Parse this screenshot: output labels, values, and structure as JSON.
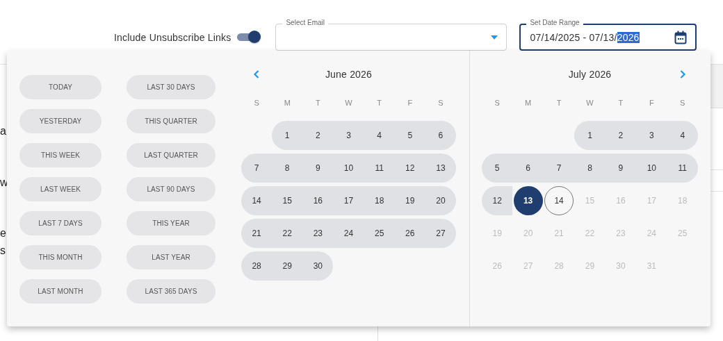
{
  "toggle": {
    "label": "Include Unsubscribe Links",
    "on": true
  },
  "email_field": {
    "label": "Select Email"
  },
  "date_field": {
    "label": "Set Date Range",
    "value": "07/14/2025 - 07/13/",
    "selected_text": "2026",
    "focused": true
  },
  "background_fragments": [
    "a",
    "w",
    "e",
    "s"
  ],
  "presets": [
    [
      "TODAY",
      "YESTERDAY",
      "THIS WEEK",
      "LAST WEEK",
      "LAST 7 DAYS",
      "THIS MONTH",
      "LAST MONTH"
    ],
    [
      "LAST 30 DAYS",
      "THIS QUARTER",
      "LAST QUARTER",
      "LAST 90 DAYS",
      "THIS YEAR",
      "LAST YEAR",
      "LAST 365 DAYS"
    ]
  ],
  "months": [
    {
      "title": "June 2026",
      "has_prev": true,
      "has_next": false,
      "weekdays": [
        "S",
        "M",
        "T",
        "W",
        "T",
        "F",
        "S"
      ],
      "weeks": [
        [
          {
            "leading_gap": true
          },
          {
            "day": "1",
            "range": true,
            "selected": false,
            "today": false,
            "disabled": false
          },
          {
            "day": "2",
            "range": true,
            "selected": false,
            "today": false,
            "disabled": false
          },
          {
            "day": "3",
            "range": true,
            "selected": false,
            "today": false,
            "disabled": false
          },
          {
            "day": "4",
            "range": true,
            "selected": false,
            "today": false,
            "disabled": false
          },
          {
            "day": "5",
            "range": true,
            "selected": false,
            "today": false,
            "disabled": false
          },
          {
            "day": "6",
            "range": true,
            "selected": false,
            "today": false,
            "disabled": false
          }
        ],
        [
          {
            "day": "7",
            "range": true,
            "selected": false,
            "today": false,
            "disabled": false
          },
          {
            "day": "8",
            "range": true,
            "selected": false,
            "today": false,
            "disabled": false
          },
          {
            "day": "9",
            "range": true,
            "selected": false,
            "today": false,
            "disabled": false
          },
          {
            "day": "10",
            "range": true,
            "selected": false,
            "today": false,
            "disabled": false
          },
          {
            "day": "11",
            "range": true,
            "selected": false,
            "today": false,
            "disabled": false
          },
          {
            "day": "12",
            "range": true,
            "selected": false,
            "today": false,
            "disabled": false
          },
          {
            "day": "13",
            "range": true,
            "selected": false,
            "today": false,
            "disabled": false
          }
        ],
        [
          {
            "day": "14",
            "range": true,
            "selected": false,
            "today": false,
            "disabled": false
          },
          {
            "day": "15",
            "range": true,
            "selected": false,
            "today": false,
            "disabled": false
          },
          {
            "day": "16",
            "range": true,
            "selected": false,
            "today": false,
            "disabled": false
          },
          {
            "day": "17",
            "range": true,
            "selected": false,
            "today": false,
            "disabled": false
          },
          {
            "day": "18",
            "range": true,
            "selected": false,
            "today": false,
            "disabled": false
          },
          {
            "day": "19",
            "range": true,
            "selected": false,
            "today": false,
            "disabled": false
          },
          {
            "day": "20",
            "range": true,
            "selected": false,
            "today": false,
            "disabled": false
          }
        ],
        [
          {
            "day": "21",
            "range": true,
            "selected": false,
            "today": false,
            "disabled": false
          },
          {
            "day": "22",
            "range": true,
            "selected": false,
            "today": false,
            "disabled": false
          },
          {
            "day": "23",
            "range": true,
            "selected": false,
            "today": false,
            "disabled": false
          },
          {
            "day": "24",
            "range": true,
            "selected": false,
            "today": false,
            "disabled": false
          },
          {
            "day": "25",
            "range": true,
            "selected": false,
            "today": false,
            "disabled": false
          },
          {
            "day": "26",
            "range": true,
            "selected": false,
            "today": false,
            "disabled": false
          },
          {
            "day": "27",
            "range": true,
            "selected": false,
            "today": false,
            "disabled": false
          }
        ],
        [
          {
            "day": "28",
            "range": true,
            "selected": false,
            "today": false,
            "disabled": false
          },
          {
            "day": "29",
            "range": true,
            "selected": false,
            "today": false,
            "disabled": false
          },
          {
            "day": "30",
            "range": true,
            "selected": false,
            "today": false,
            "disabled": false
          }
        ]
      ]
    },
    {
      "title": "July 2026",
      "has_prev": false,
      "has_next": true,
      "weekdays": [
        "S",
        "M",
        "T",
        "W",
        "T",
        "F",
        "S"
      ],
      "weeks": [
        [
          {
            "leading_gap": true
          },
          {
            "day": "1",
            "range": true,
            "selected": false,
            "today": false,
            "disabled": false
          },
          {
            "day": "2",
            "range": true,
            "selected": false,
            "today": false,
            "disabled": false
          },
          {
            "day": "3",
            "range": true,
            "selected": false,
            "today": false,
            "disabled": false
          },
          {
            "day": "4",
            "range": true,
            "selected": false,
            "today": false,
            "disabled": false
          }
        ],
        [
          {
            "day": "5",
            "range": true,
            "selected": false,
            "today": false,
            "disabled": false
          },
          {
            "day": "6",
            "range": true,
            "selected": false,
            "today": false,
            "disabled": false
          },
          {
            "day": "7",
            "range": true,
            "selected": false,
            "today": false,
            "disabled": false
          },
          {
            "day": "8",
            "range": true,
            "selected": false,
            "today": false,
            "disabled": false
          },
          {
            "day": "9",
            "range": true,
            "selected": false,
            "today": false,
            "disabled": false
          },
          {
            "day": "10",
            "range": true,
            "selected": false,
            "today": false,
            "disabled": false
          },
          {
            "day": "11",
            "range": true,
            "selected": false,
            "today": false,
            "disabled": false
          }
        ],
        [
          {
            "day": "12",
            "range": true,
            "selected": false,
            "today": false,
            "disabled": false
          },
          {
            "day": "13",
            "range": true,
            "selected": true,
            "today": false,
            "disabled": false
          },
          {
            "day": "14",
            "range": false,
            "selected": false,
            "today": true,
            "disabled": false
          },
          {
            "day": "15",
            "range": false,
            "selected": false,
            "today": false,
            "disabled": true
          },
          {
            "day": "16",
            "range": false,
            "selected": false,
            "today": false,
            "disabled": true
          },
          {
            "day": "17",
            "range": false,
            "selected": false,
            "today": false,
            "disabled": true
          },
          {
            "day": "18",
            "range": false,
            "selected": false,
            "today": false,
            "disabled": true
          }
        ],
        [
          {
            "day": "19",
            "range": false,
            "selected": false,
            "today": false,
            "disabled": true
          },
          {
            "day": "20",
            "range": false,
            "selected": false,
            "today": false,
            "disabled": true
          },
          {
            "day": "21",
            "range": false,
            "selected": false,
            "today": false,
            "disabled": true
          },
          {
            "day": "22",
            "range": false,
            "selected": false,
            "today": false,
            "disabled": true
          },
          {
            "day": "23",
            "range": false,
            "selected": false,
            "today": false,
            "disabled": true
          },
          {
            "day": "24",
            "range": false,
            "selected": false,
            "today": false,
            "disabled": true
          },
          {
            "day": "25",
            "range": false,
            "selected": false,
            "today": false,
            "disabled": true
          }
        ],
        [
          {
            "day": "26",
            "range": false,
            "selected": false,
            "today": false,
            "disabled": true
          },
          {
            "day": "27",
            "range": false,
            "selected": false,
            "today": false,
            "disabled": true
          },
          {
            "day": "28",
            "range": false,
            "selected": false,
            "today": false,
            "disabled": true
          },
          {
            "day": "29",
            "range": false,
            "selected": false,
            "today": false,
            "disabled": true
          },
          {
            "day": "30",
            "range": false,
            "selected": false,
            "today": false,
            "disabled": true
          },
          {
            "day": "31",
            "range": false,
            "selected": false,
            "today": false,
            "disabled": true
          }
        ]
      ]
    }
  ]
}
